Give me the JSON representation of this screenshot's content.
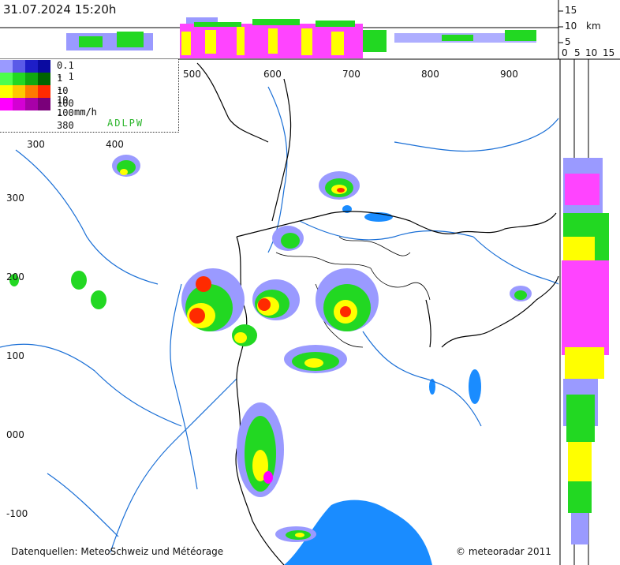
{
  "header": {
    "timestamp": "31.07.2024 15:20h"
  },
  "legend": {
    "title": "ADLPW",
    "unit": "mm/h",
    "classes": [
      {
        "label": "0.1 -    1",
        "colors": [
          "#9a9aff",
          "#5a5ae8",
          "#1e1ec8",
          "#0a0aa0"
        ]
      },
      {
        "label": "  1 -   10",
        "colors": [
          "#4cff4c",
          "#22d822",
          "#0fa80f",
          "#006400"
        ]
      },
      {
        "label": " 10 -  100",
        "colors": [
          "#ffff00",
          "#ffc800",
          "#ff7a00",
          "#ff2a00"
        ]
      },
      {
        "label": "100 -  380",
        "colors": [
          "#ff00ff",
          "#d400d4",
          "#a800a8",
          "#7a007a"
        ]
      }
    ]
  },
  "axes": {
    "x_ticks": [
      "500",
      "600",
      "700",
      "800",
      "900"
    ],
    "x_ticks_left": [
      "300",
      "400"
    ],
    "y_ticks": [
      "300",
      "200",
      "100",
      "000",
      "-100"
    ],
    "height_ticks": [
      "15",
      "10",
      "5"
    ],
    "height_unit": "km",
    "side_ticks": [
      "0",
      "5",
      "10",
      "15"
    ]
  },
  "footer": {
    "source": "Datenquellen: MeteoSchweiz und Météorage",
    "copyright": "© meteoradar 2011"
  },
  "colors": {
    "river": "#1a6fd6",
    "lake": "#1a8cff",
    "border": "#000000",
    "background": "#ffffff"
  }
}
